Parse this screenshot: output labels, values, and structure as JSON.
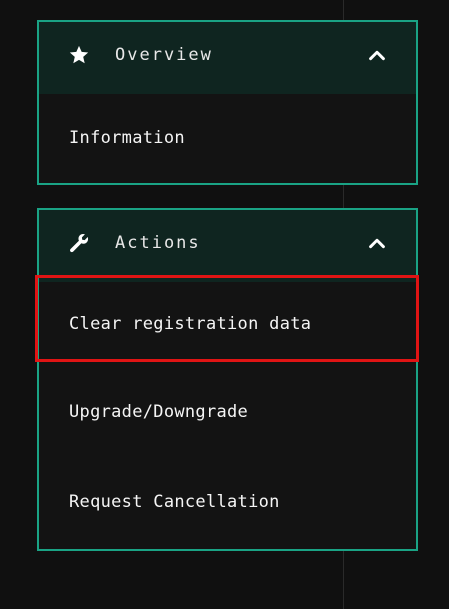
{
  "panels": {
    "overview": {
      "title": "Overview",
      "icon": "star-icon",
      "items": [
        "Information"
      ]
    },
    "actions": {
      "title": "Actions",
      "icon": "wrench-icon",
      "items": [
        "Clear registration data",
        "Upgrade/Downgrade",
        "Request Cancellation"
      ]
    }
  },
  "colors": {
    "accent": "#1aa385",
    "header_bg": "#0f2520",
    "page_bg": "#101010",
    "highlight": "#e01414"
  }
}
